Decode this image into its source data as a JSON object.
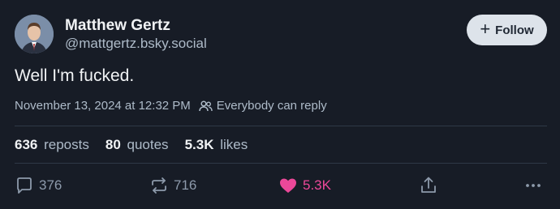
{
  "author": {
    "name": "Matthew Gertz",
    "handle": "@mattgertz.bsky.social"
  },
  "follow_button": {
    "label": "Follow"
  },
  "post": {
    "text": "Well I'm fucked.",
    "timestamp": "November 13, 2024 at 12:32 PM",
    "reply_setting": "Everybody can reply"
  },
  "stats": {
    "reposts": {
      "count": "636",
      "label": "reposts"
    },
    "quotes": {
      "count": "80",
      "label": "quotes"
    },
    "likes": {
      "count": "5.3K",
      "label": "likes"
    }
  },
  "actions": {
    "replies": "376",
    "reposts": "716",
    "likes": "5.3K"
  },
  "colors": {
    "background": "#171c26",
    "like_accent": "#ec4899",
    "follow_button_bg": "#dde3ea"
  }
}
